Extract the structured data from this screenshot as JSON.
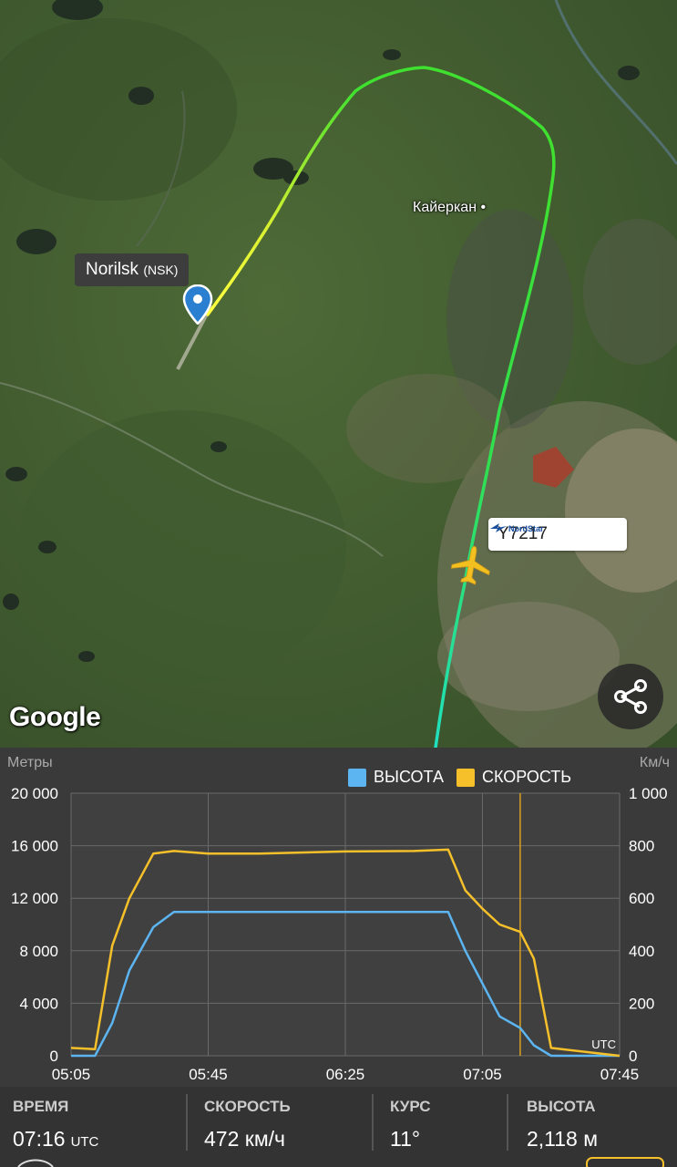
{
  "map": {
    "airport": {
      "name": "Norilsk",
      "code": "(NSK)"
    },
    "place_label": "Кайеркан",
    "flight": {
      "number": "Y7217",
      "airline_logo_text": "NordStar"
    },
    "attribution": "Google",
    "share_icon": "share-icon",
    "colors": {
      "track_green": "#33e033",
      "track_yellow": "#eeee22",
      "plane": "#f4c020",
      "pin": "#2a7fd0"
    }
  },
  "graph": {
    "left_axis_title": "Метры",
    "right_axis_title": "Км/ч",
    "utc_label": "UTC",
    "legend": [
      {
        "label": "ВЫСОТА",
        "color": "#5cb4f0"
      },
      {
        "label": "СКОРОСТЬ",
        "color": "#f5c02a"
      }
    ]
  },
  "chart_data": {
    "type": "line",
    "x": [
      "05:05",
      "05:12",
      "05:17",
      "05:22",
      "05:29",
      "05:35",
      "05:45",
      "06:00",
      "06:25",
      "06:45",
      "06:55",
      "07:00",
      "07:05",
      "07:10",
      "07:16",
      "07:20",
      "07:25",
      "07:45"
    ],
    "x_ticks": [
      "05:05",
      "05:45",
      "06:25",
      "07:05",
      "07:45"
    ],
    "series": [
      {
        "name": "ВЫСОТА",
        "axis": "left",
        "color": "#5cb4f0",
        "values": [
          0,
          0,
          2500,
          6500,
          9800,
          10950,
          10950,
          10950,
          10950,
          10950,
          10950,
          8000,
          5500,
          3000,
          2118,
          800,
          0,
          0
        ]
      },
      {
        "name": "СКОРОСТЬ",
        "axis": "right",
        "color": "#f5c02a",
        "values": [
          30,
          25,
          420,
          600,
          770,
          780,
          770,
          770,
          778,
          780,
          785,
          630,
          560,
          500,
          472,
          370,
          30,
          0
        ]
      }
    ],
    "y_left": {
      "ticks": [
        "0",
        "4 000",
        "8 000",
        "12 000",
        "16 000",
        "20 000"
      ],
      "ylim": [
        0,
        20000
      ]
    },
    "y_right": {
      "ticks": [
        "0",
        "200",
        "400",
        "600",
        "800",
        "1 000"
      ],
      "ylim": [
        0,
        1000
      ]
    },
    "current_time_marker": "07:16"
  },
  "stats": [
    {
      "label": "ВРЕМЯ",
      "value": "07:16",
      "unit": "UTC"
    },
    {
      "label": "СКОРОСТЬ",
      "value": "472 км/ч",
      "unit": ""
    },
    {
      "label": "КУРС",
      "value": "11°",
      "unit": ""
    },
    {
      "label": "ВЫСОТА",
      "value": "2,118 м",
      "unit": ""
    }
  ]
}
